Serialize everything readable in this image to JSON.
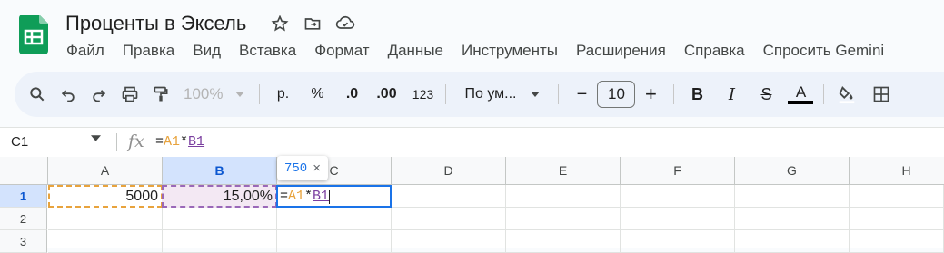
{
  "app": {
    "doc_title": "Проценты в Эксель"
  },
  "title_icons": [
    "star-icon",
    "move-to-folder-icon",
    "cloud-status-icon"
  ],
  "menu": [
    "Файл",
    "Правка",
    "Вид",
    "Вставка",
    "Формат",
    "Данные",
    "Инструменты",
    "Расширения",
    "Справка",
    "Спросить Gemini"
  ],
  "toolbar": {
    "zoom": "100%",
    "currency": "р.",
    "percent": "%",
    "decrease_decimal": ".0",
    "increase_decimal": ".00",
    "more_formats": "123",
    "font": "По ум...",
    "font_size": "10",
    "minus": "−",
    "plus": "+",
    "bold": "B",
    "italic": "I",
    "strike": "S",
    "text_color": "A"
  },
  "formula_bar": {
    "name_box": "C1",
    "fx": "fx",
    "formula_eq": "=",
    "formula_a": "A1",
    "formula_op": "*",
    "formula_b": "B1"
  },
  "columns": [
    "A",
    "B",
    "C",
    "D",
    "E",
    "F",
    "G",
    "H"
  ],
  "rows": [
    "1",
    "2",
    "3"
  ],
  "cells": {
    "A1": "5000",
    "B1": "15,00%"
  },
  "tooltip": {
    "value": "750",
    "close": "×"
  },
  "colors": {
    "ref_a": "#e8a33d",
    "ref_b": "#9a68b8",
    "active": "#1a73e8",
    "sheets_green": "#0f9d58"
  }
}
